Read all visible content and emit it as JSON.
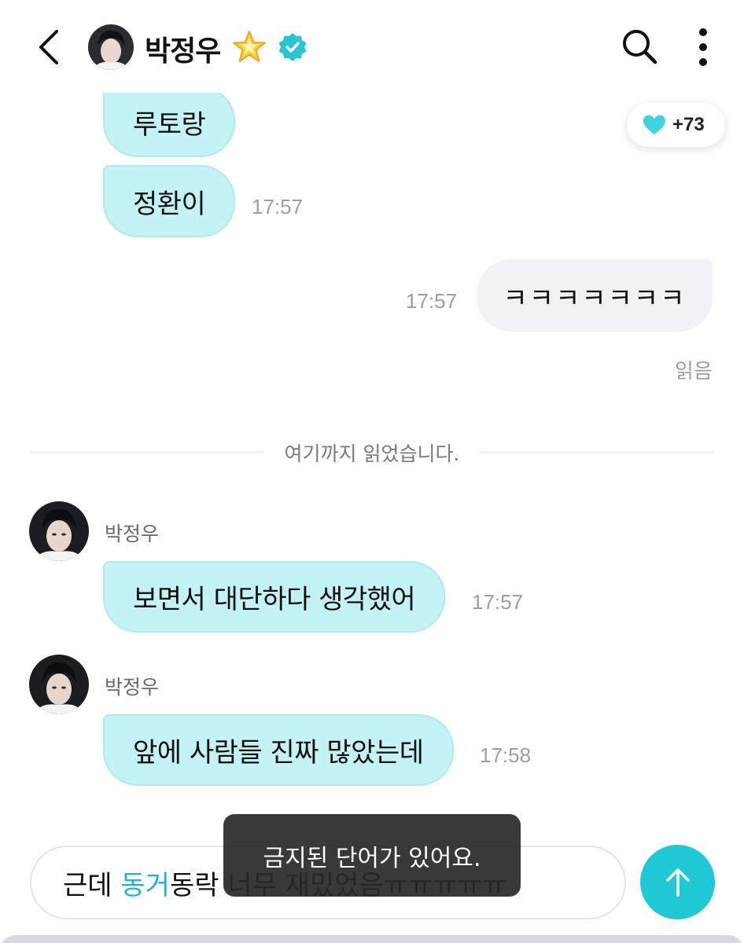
{
  "header": {
    "title": "박정우",
    "back_icon": "chevron-left-icon",
    "star_icon": "glowing-star-icon",
    "verified_icon": "verified-badge-icon",
    "search_icon": "search-icon",
    "more_icon": "more-vertical-icon"
  },
  "reactions": {
    "count": "+73",
    "icon": "heart-icon",
    "color": "#3fd3de"
  },
  "messages": [
    {
      "direction": "in",
      "text": "루토랑",
      "time": ""
    },
    {
      "direction": "in",
      "text": "정환이",
      "time": "17:57"
    },
    {
      "direction": "out",
      "text": "ㅋㅋㅋㅋㅋㅋㅋ",
      "time": "17:57",
      "status": "읽음"
    }
  ],
  "divider": {
    "text": "여기까지 읽었습니다."
  },
  "new_messages": [
    {
      "sender": "박정우",
      "text": "보면서 대단하다 생각했어",
      "time": "17:57"
    },
    {
      "sender": "박정우",
      "text": "앞에 사람들 진짜 많았는데",
      "time": "17:58"
    }
  ],
  "toast": {
    "text": "금지된 단어가 있어요."
  },
  "composer": {
    "text_before": "근데 ",
    "text_highlight": "동거",
    "text_after": "동락 너무 재밌었음ㅠㅠㅠㅠㅠ",
    "send_icon": "arrow-up-icon"
  },
  "colors": {
    "accent": "#1fcad6",
    "bubble_in": "#c4f3f5",
    "bubble_out": "#f1f2f6",
    "highlight": "#1fb4c6"
  }
}
